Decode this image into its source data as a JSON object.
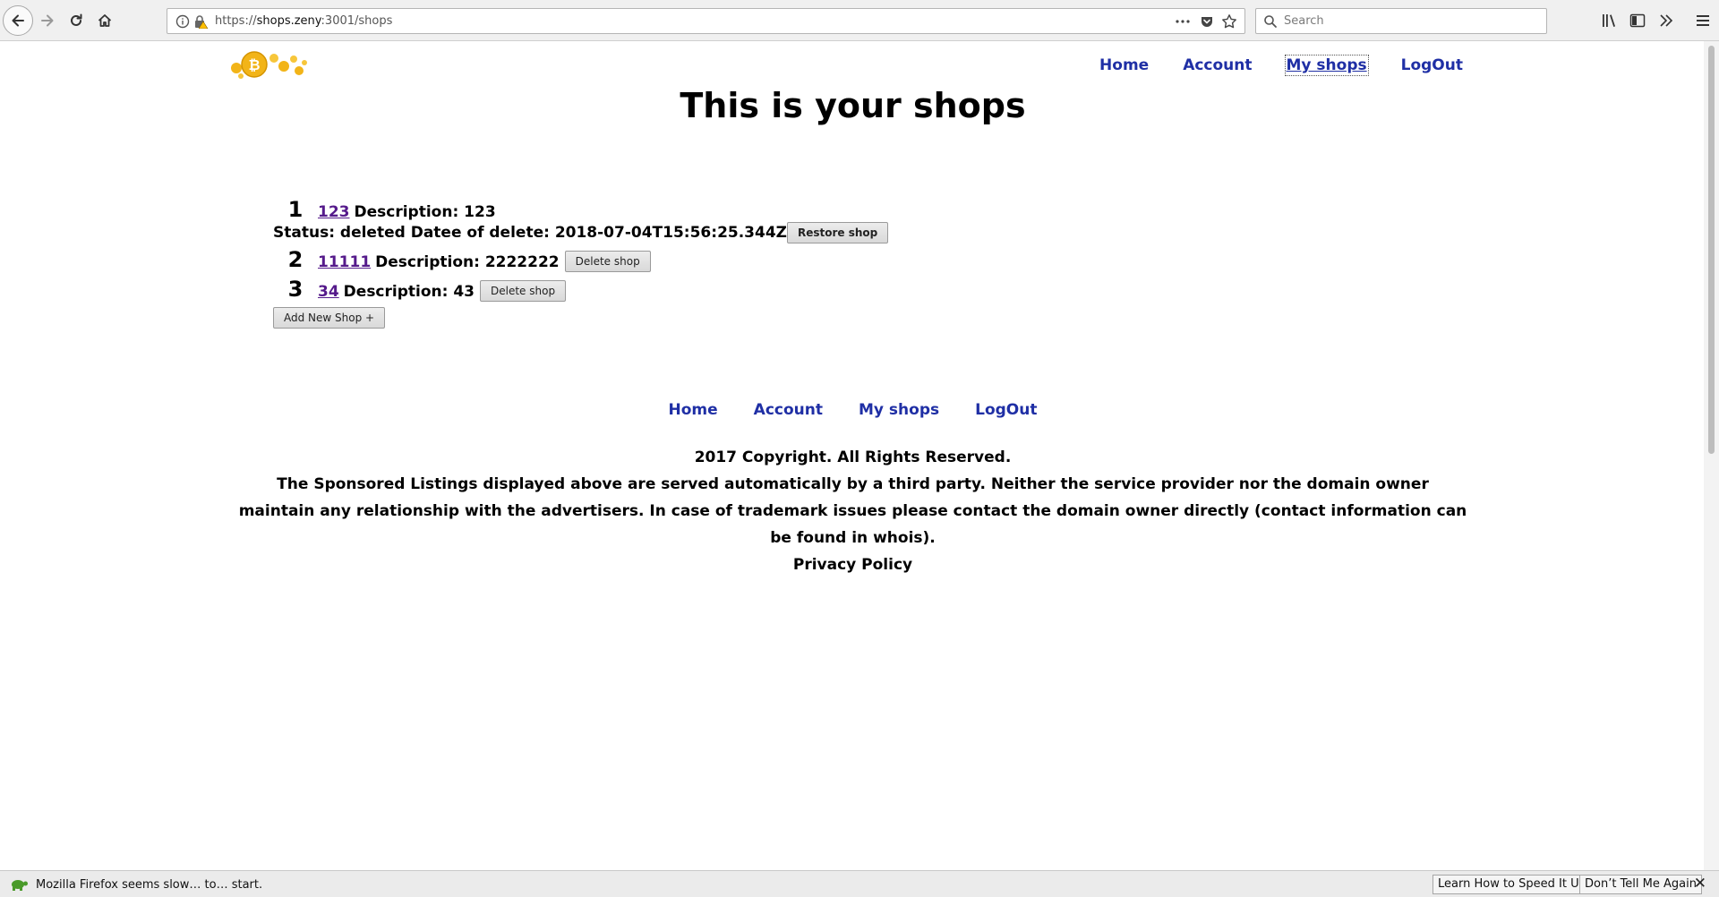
{
  "browser": {
    "url_scheme": "https://",
    "url_host": "shops.zeny",
    "url_rest": ":3001/shops",
    "search_placeholder": "Search"
  },
  "nav": {
    "items": [
      {
        "label": "Home"
      },
      {
        "label": "Account"
      },
      {
        "label": "My shops",
        "active": true
      },
      {
        "label": "LogOut"
      }
    ]
  },
  "page": {
    "title": "This is your shops"
  },
  "shops": [
    {
      "number": "1",
      "name": "123",
      "description": "Description: 123",
      "status": "Status: deleted Datee of delete: 2018-07-04T15:56:25.344Z",
      "action": "Restore shop"
    },
    {
      "number": "2",
      "name": "11111",
      "description": "Description: 2222222",
      "action": "Delete shop"
    },
    {
      "number": "3",
      "name": "34",
      "description": "Description: 43",
      "action": "Delete shop"
    }
  ],
  "add_shop_label": "Add New Shop +",
  "footer": {
    "copyright": "2017 Copyright. All Rights Reserved.",
    "disclaimer": "The Sponsored Listings displayed above are served automatically by a third party. Neither the service provider nor the domain owner maintain any relationship with the advertisers. In case of trademark issues please contact the domain owner directly (contact information can be found in whois).",
    "privacy": "Privacy Policy"
  },
  "notification": {
    "message": "Mozilla Firefox seems slow… to… start.",
    "learn_label": "Learn How to Speed It Up",
    "dismiss_label": "Don’t Tell Me Again"
  },
  "colors": {
    "nav_link": "#1f2fa5",
    "visited_link": "#551a8b",
    "logo_coin": "#f2b418"
  }
}
